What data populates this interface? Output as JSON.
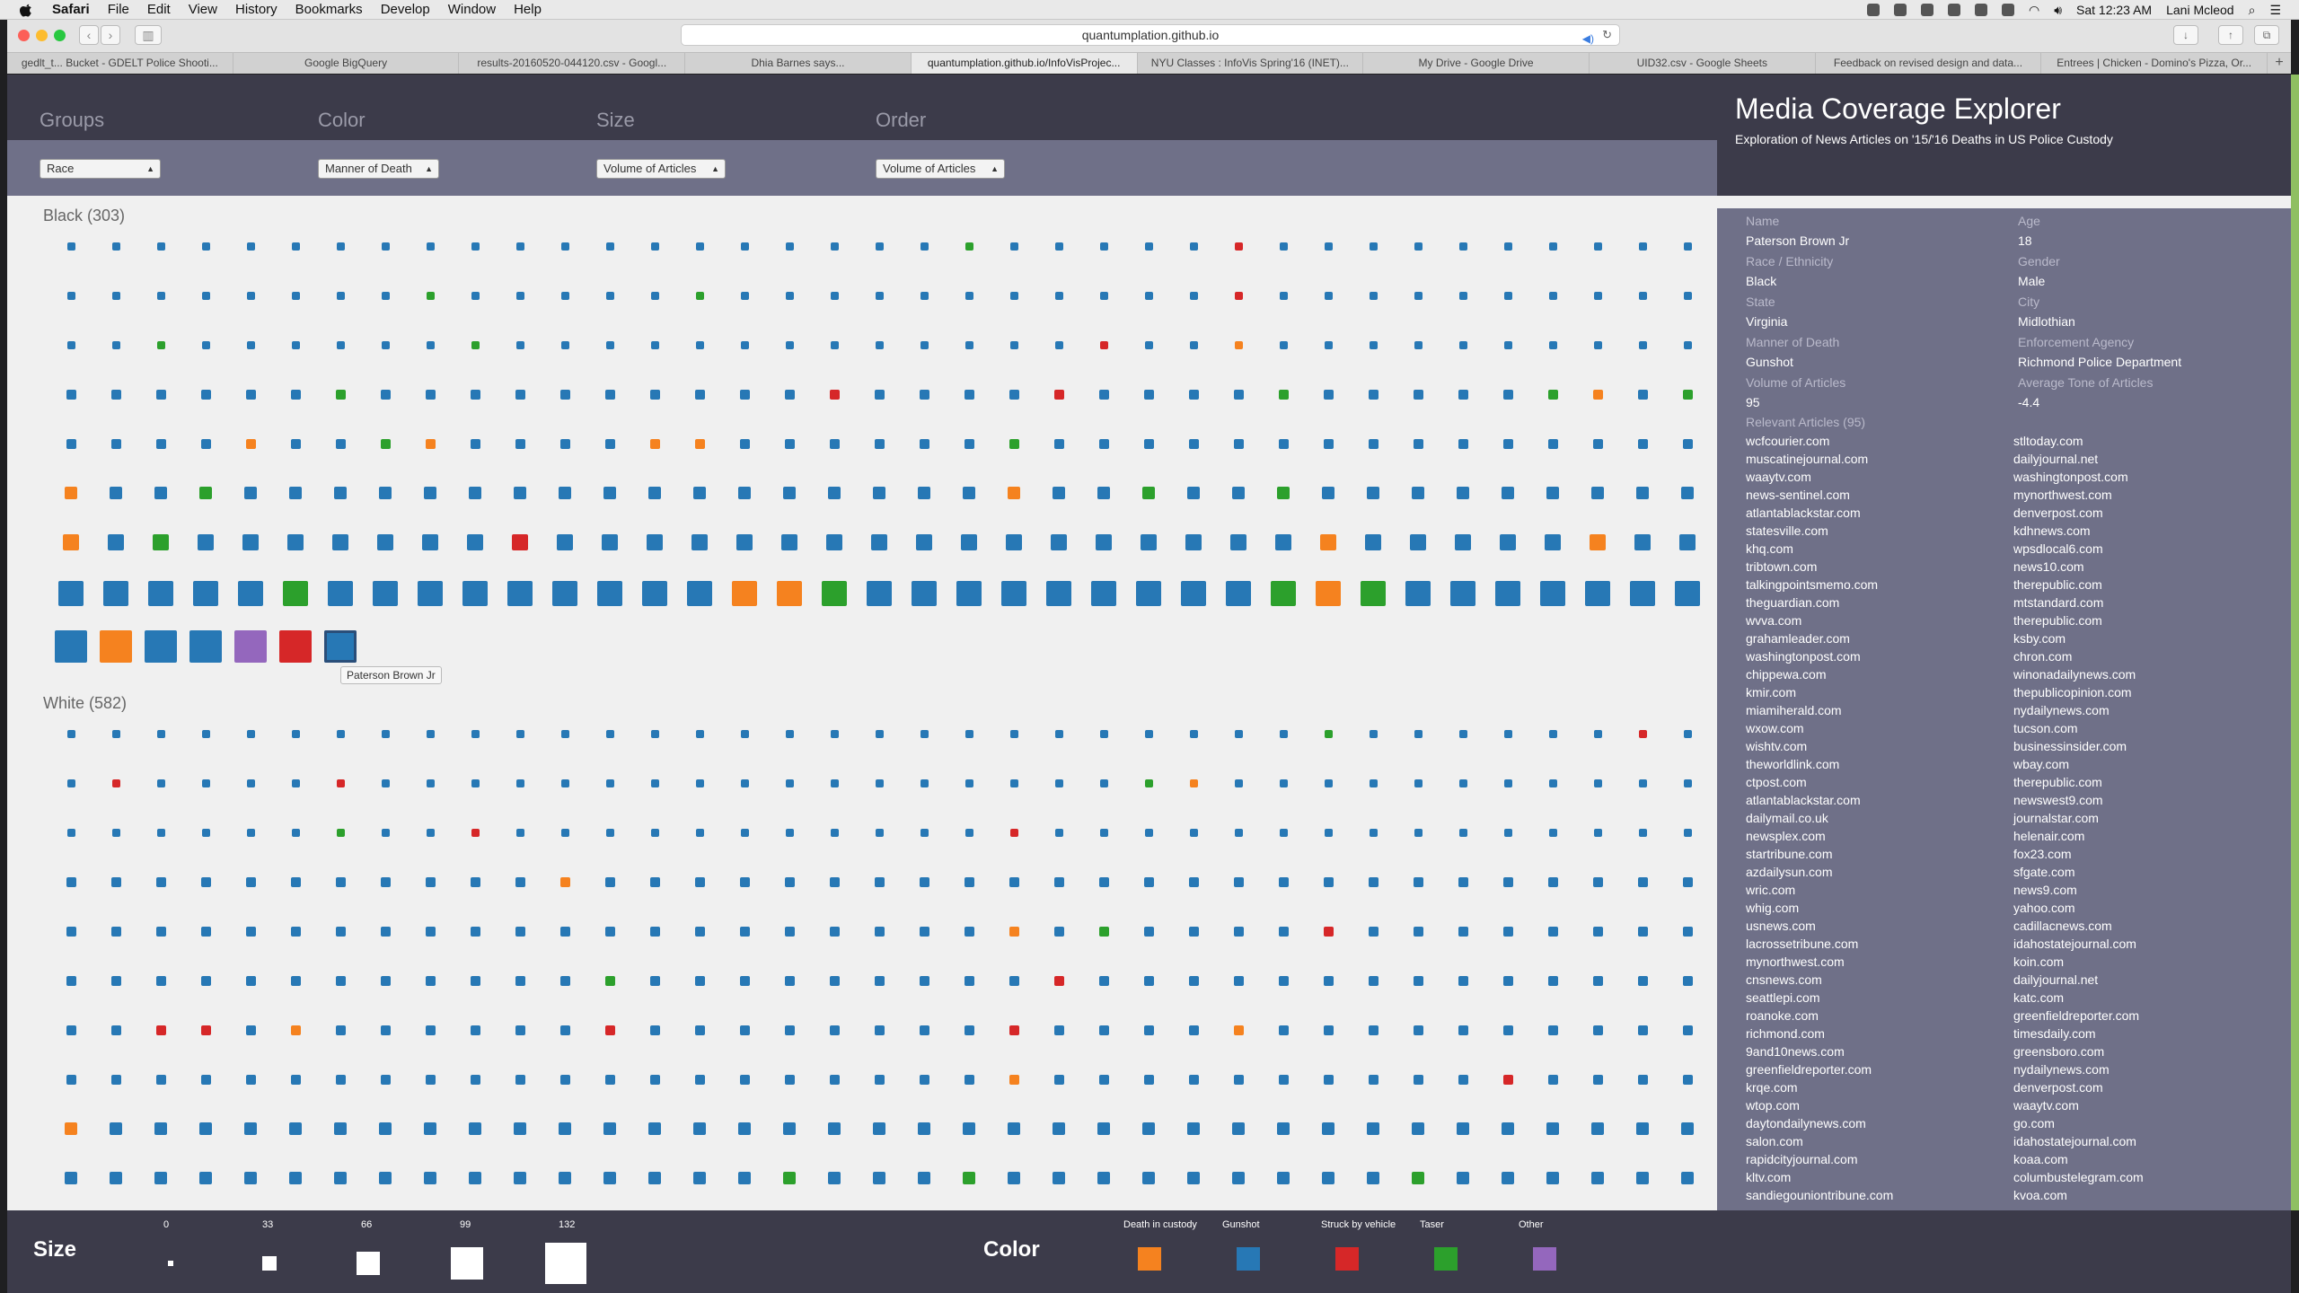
{
  "menubar": {
    "app": "Safari",
    "items": [
      "File",
      "Edit",
      "View",
      "History",
      "Bookmarks",
      "Develop",
      "Window",
      "Help"
    ],
    "clock": "Sat 12:23 AM",
    "user": "Lani Mcleod"
  },
  "browser": {
    "url": "quantumplation.github.io",
    "tabs": [
      {
        "label": "gedlt_t... Bucket - GDELT Police Shooti...",
        "active": false
      },
      {
        "label": "Google BigQuery",
        "active": false
      },
      {
        "label": "results-20160520-044120.csv - Googl...",
        "active": false
      },
      {
        "label": "Dhia Barnes says...",
        "active": false
      },
      {
        "label": "quantumplation.github.io/InfoVisProjec...",
        "active": true
      },
      {
        "label": "NYU Classes : InfoVis Spring'16 (INET)...",
        "active": false
      },
      {
        "label": "My Drive - Google Drive",
        "active": false
      },
      {
        "label": "UID32.csv - Google Sheets",
        "active": false
      },
      {
        "label": "Feedback on revised design and data...",
        "active": false
      },
      {
        "label": "Entrees | Chicken - Domino's Pizza, Or...",
        "active": false
      }
    ]
  },
  "controls": {
    "groups": {
      "label": "Groups",
      "value": "Race"
    },
    "color": {
      "label": "Color",
      "value": "Manner of Death"
    },
    "size": {
      "label": "Size",
      "value": "Volume of Articles"
    },
    "order": {
      "label": "Order",
      "value": "Volume of Articles"
    }
  },
  "header": {
    "title": "Media Coverage Explorer",
    "subtitle": "Exploration of News Articles on '15/'16 Deaths in US Police Custody"
  },
  "colors": {
    "death_in_custody": "#f5821f",
    "gunshot": "#2778b5",
    "struck_by_vehicle": "#d62728",
    "taser": "#2ca02c",
    "other": "#9467bd"
  },
  "groups": [
    {
      "title": "Black (303)"
    },
    {
      "title": "White (582)"
    }
  ],
  "tooltip": "Paterson Brown Jr",
  "detail": {
    "fields": [
      {
        "key": "Name",
        "value": "Paterson Brown Jr"
      },
      {
        "key": "Age",
        "value": "18"
      },
      {
        "key": "Race / Ethnicity",
        "value": "Black"
      },
      {
        "key": "Gender",
        "value": "Male"
      },
      {
        "key": "State",
        "value": "Virginia"
      },
      {
        "key": "City",
        "value": "Midlothian"
      },
      {
        "key": "Manner of Death",
        "value": "Gunshot"
      },
      {
        "key": "Enforcement Agency",
        "value": "Richmond Police Department"
      },
      {
        "key": "Volume of Articles",
        "value": "95"
      },
      {
        "key": "Average Tone of Articles",
        "value": "-4.4"
      }
    ],
    "articles_label": "Relevant Articles (95)",
    "articles_left": [
      "wcfcourier.com",
      "muscatinejournal.com",
      "waaytv.com",
      "news-sentinel.com",
      "atlantablackstar.com",
      "statesville.com",
      "khq.com",
      "tribtown.com",
      "talkingpointsmemo.com",
      "theguardian.com",
      "wvva.com",
      "grahamleader.com",
      "washingtonpost.com",
      "chippewa.com",
      "kmir.com",
      "miamiherald.com",
      "wxow.com",
      "wishtv.com",
      "theworldlink.com",
      "ctpost.com",
      "atlantablackstar.com",
      "dailymail.co.uk",
      "newsplex.com",
      "startribune.com",
      "azdailysun.com",
      "wric.com",
      "whig.com",
      "usnews.com",
      "lacrossetribune.com",
      "mynorthwest.com",
      "cnsnews.com",
      "seattlepi.com",
      "roanoke.com",
      "richmond.com",
      "9and10news.com",
      "greenfieldreporter.com",
      "krqe.com",
      "wtop.com",
      "daytondailynews.com",
      "salon.com",
      "rapidcityjournal.com",
      "kltv.com",
      "sandiegouniontribune.com"
    ],
    "articles_right": [
      "stltoday.com",
      "dailyjournal.net",
      "washingtonpost.com",
      "mynorthwest.com",
      "denverpost.com",
      "kdhnews.com",
      "wpsdlocal6.com",
      "news10.com",
      "therepublic.com",
      "mtstandard.com",
      "therepublic.com",
      "ksby.com",
      "chron.com",
      "winonadailynews.com",
      "thepublicopinion.com",
      "nydailynews.com",
      "tucson.com",
      "businessinsider.com",
      "wbay.com",
      "therepublic.com",
      "newswest9.com",
      "journalstar.com",
      "helenair.com",
      "fox23.com",
      "sfgate.com",
      "news9.com",
      "yahoo.com",
      "cadillacnews.com",
      "idahostatejournal.com",
      "koin.com",
      "dailyjournal.net",
      "katc.com",
      "greenfieldreporter.com",
      "timesdaily.com",
      "greensboro.com",
      "nydailynews.com",
      "denverpost.com",
      "waaytv.com",
      "go.com",
      "idahostatejournal.com",
      "koaa.com",
      "columbustelegram.com",
      "kvoa.com"
    ]
  },
  "legend": {
    "size_title": "Size",
    "size_ticks": [
      "0",
      "33",
      "66",
      "99",
      "132"
    ],
    "color_title": "Color",
    "color_items": [
      {
        "label": "Death in custody",
        "color": "#f5821f"
      },
      {
        "label": "Gunshot",
        "color": "#2778b5"
      },
      {
        "label": "Struck by vehicle",
        "color": "#d62728"
      },
      {
        "label": "Taser",
        "color": "#2ca02c"
      },
      {
        "label": "Other",
        "color": "#9467bd"
      }
    ]
  },
  "chart_data": {
    "type": "scatter",
    "title": "",
    "xlabel": "",
    "ylabel": "",
    "groups": [
      {
        "name": "Black",
        "count": 303,
        "rows": [
          {
            "size": "xs",
            "colors": "GGGGGGGGGGGGGGGGGGGGTGGGGGRGGGGGGGGGGG"
          },
          {
            "size": "xs",
            "colors": "GGGGGGGGTGGGGGTGGGGGGGGGGGRGGGGGGGGGGG"
          },
          {
            "size": "xs",
            "colors": "GGTGGGGGGTGGGGGGGGGGGGGRGGOGGGGGGGGGGG"
          },
          {
            "size": "s",
            "colors": "GGGGGGTGGGGGGGGGGRGGGGRGGGGTGGGGGTOGTG"
          },
          {
            "size": "s",
            "colors": "GGGGOGGTOGGGGOOGGGGGGTGGGGGGGGGGGGGGGG"
          },
          {
            "size": "m",
            "colors": "OGGTGGGGGGGGGGGGGGGGGOGGTGGTGGGGGGGGGG"
          },
          {
            "size": "l",
            "colors": "OGTGGGGGGGRGGGGGGGGGGGGGGGGGOGGGGGOGGG"
          },
          {
            "size": "xl",
            "colors": "GGGGGTGGGGGGGGGOOTGGGGGGGGGTOTGGGGGGGG"
          },
          {
            "size": "xxl",
            "colors": "GOGGPRG"
          }
        ]
      },
      {
        "name": "White",
        "count": 582,
        "rows": [
          {
            "size": "xs",
            "colors": "GGGGGGGGGGGGGGGGGGGGGGGGGGGGTGGGGGGRGG"
          },
          {
            "size": "xs",
            "colors": "GRGGGGRGGGGGGGGGGGGGGGGGTOGGGGGGGGGGGR"
          },
          {
            "size": "xs",
            "colors": "GGGGGGTGGRGGGGGGGGGGGRGGGGGGGGGGGGGGGG"
          },
          {
            "size": "s",
            "colors": "GGGGGGGGGGGOGGGGGGGGGGGGGGGGGGGGGGGGGG"
          },
          {
            "size": "s",
            "colors": "GGGGGGGGGGGGGGGGGGGGGOGTGGGGRGGGGGGGGG"
          },
          {
            "size": "s",
            "colors": "GGGGGGGGGGGGTGGGGGGGGGRGGGGGGGGGGGGGGT"
          },
          {
            "size": "s",
            "colors": "GGRRGOGGGGGGRGGGGGGGGRGGGGOGGGGGGGGGGG"
          },
          {
            "size": "s",
            "colors": "GGGGGGGGGGGGGGGGGGGGGOGGGGGGGGGGRGGGGG"
          },
          {
            "size": "m",
            "colors": "OGGGGGGGGGGGGGGGGGGGGGGGGGGGGGGGGGGGGG"
          },
          {
            "size": "m",
            "colors": "GGGGGGGGGGGGGGGGTGGGTGGGGGGGGGTGGGGGGG"
          }
        ]
      }
    ],
    "color_codes": {
      "G": "Gunshot",
      "O": "Death in custody",
      "R": "Struck by vehicle",
      "T": "Taser",
      "P": "Other"
    },
    "selected": {
      "group": 0,
      "row": 8,
      "col": 6,
      "name": "Paterson Brown Jr"
    }
  }
}
